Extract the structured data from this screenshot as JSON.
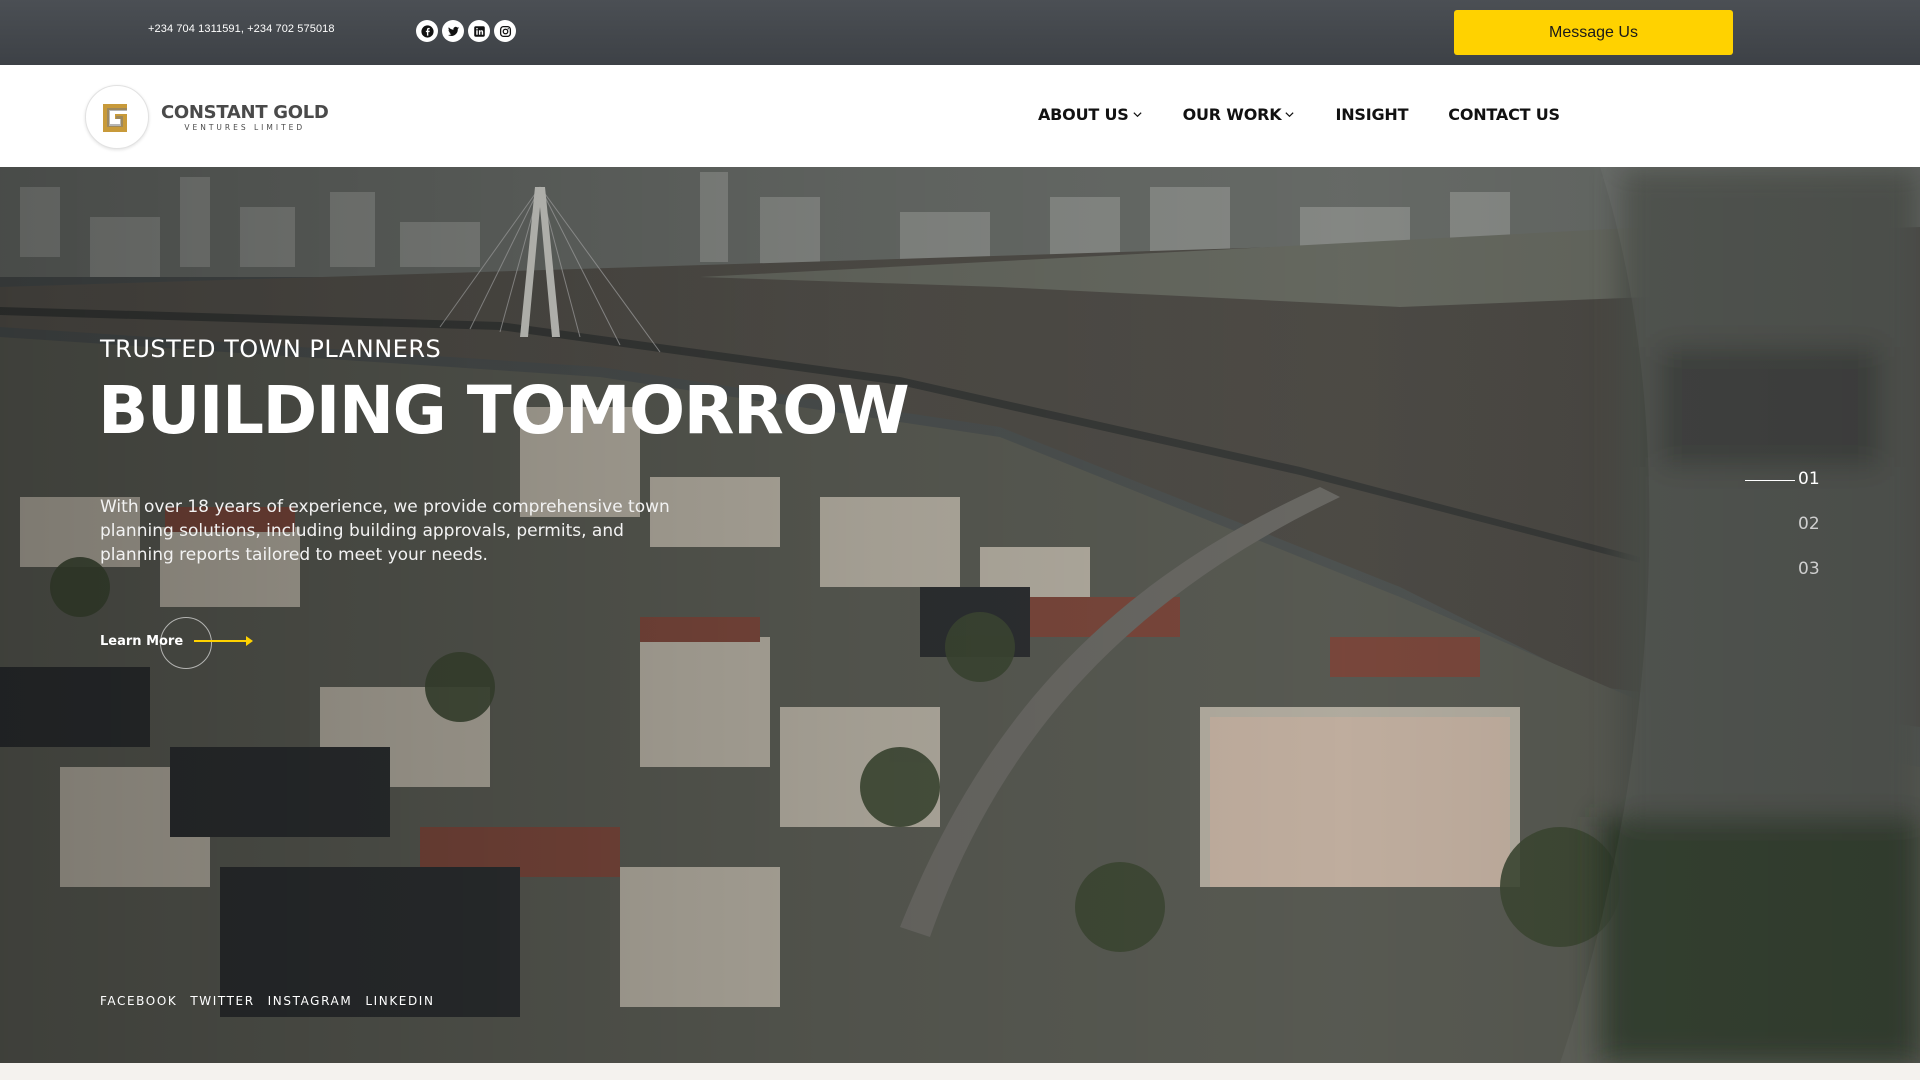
{
  "topbar": {
    "phone": "+234 704 1311591, +234 702 575018",
    "social_icons": [
      "facebook-icon",
      "twitter-icon",
      "linkedin-icon",
      "instagram-icon"
    ],
    "message_button": "Message Us",
    "accent_color": "#ffd200"
  },
  "brand": {
    "name": "CONSTANT GOLD",
    "tagline": "VENTURES LIMITED"
  },
  "nav": {
    "items": [
      {
        "label": "ABOUT US",
        "has_dropdown": true
      },
      {
        "label": "OUR WORK",
        "has_dropdown": true
      },
      {
        "label": "INSIGHT",
        "has_dropdown": false
      },
      {
        "label": "CONTACT US",
        "has_dropdown": false
      }
    ]
  },
  "hero": {
    "eyebrow": "TRUSTED TOWN PLANNERS",
    "title": "BUILDING TOMORROW",
    "description": "With over 18 years of experience, we provide comprehensive town planning solutions, including building approvals, permits, and planning reports tailored to meet your needs.",
    "cta_label": "Learn More",
    "slides": [
      "01",
      "02",
      "03"
    ],
    "active_slide": "01",
    "social_links": [
      "FACEBOOK",
      "TWITTER",
      "INSTAGRAM",
      "LINKEDIN"
    ]
  }
}
